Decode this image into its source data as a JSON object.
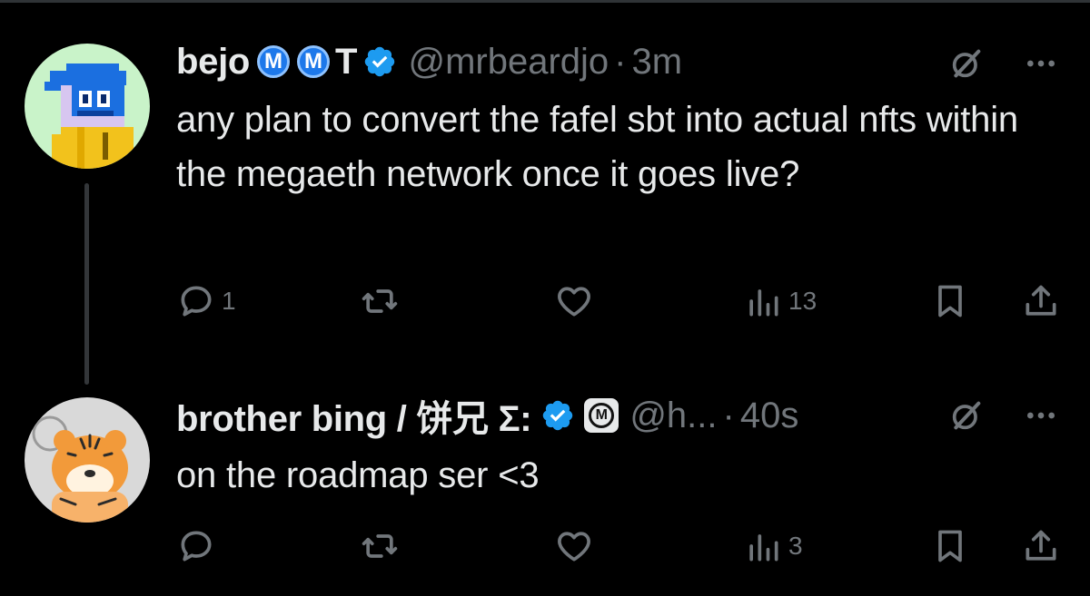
{
  "colors": {
    "background": "#000000",
    "primary_text": "#e7e9ea",
    "secondary_text": "#71767b",
    "verified_blue": "#1d9bf0",
    "thread_line": "#333639"
  },
  "tweets": [
    {
      "display_name": "bejo",
      "badges": [
        "M",
        "M"
      ],
      "suffix_letter": "T",
      "handle": "@mrbeardjo",
      "separator": "·",
      "time": "3m",
      "text": "any plan to convert the fafel sbt into actual nfts within the megaeth network once it goes live?",
      "actions": {
        "reply_count": "1",
        "repost_count": "",
        "like_count": "",
        "views_count": "13"
      },
      "icons": [
        "grok-icon",
        "more-icon",
        "reply-icon",
        "repost-icon",
        "like-icon",
        "views-icon",
        "bookmark-icon",
        "share-icon"
      ]
    },
    {
      "display_name": "brother bing / 饼兄 Σ:",
      "badge_m": "M",
      "handle": "@h...",
      "separator": "·",
      "time": "40s",
      "text": "on the roadmap ser <3",
      "actions": {
        "reply_count": "",
        "repost_count": "",
        "like_count": "",
        "views_count": "3"
      },
      "icons": [
        "grok-icon",
        "more-icon",
        "reply-icon",
        "repost-icon",
        "like-icon",
        "views-icon",
        "bookmark-icon",
        "share-icon"
      ]
    }
  ]
}
